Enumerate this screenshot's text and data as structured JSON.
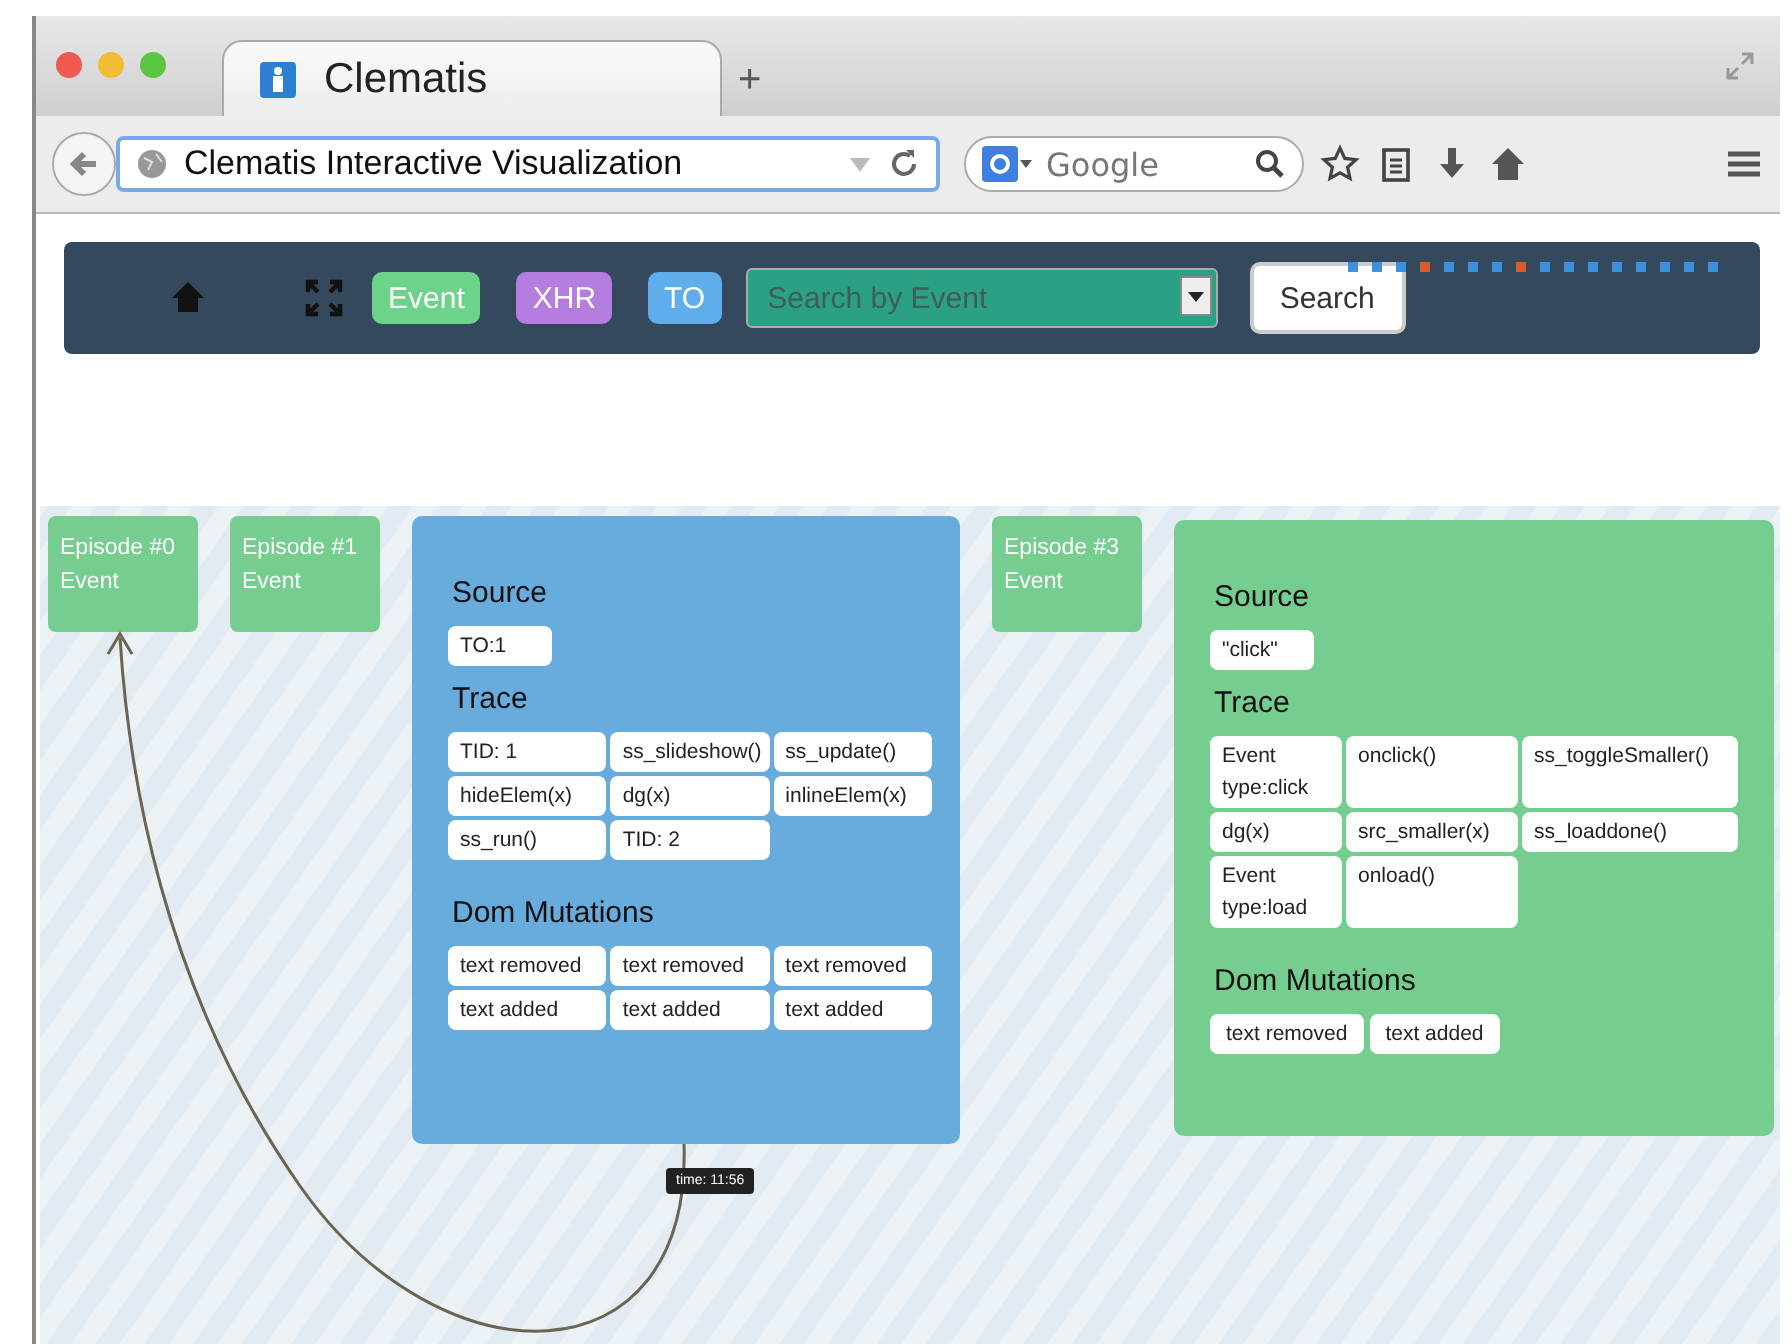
{
  "browser": {
    "tab_title": "Clematis",
    "new_tab": "+",
    "address": "Clematis Interactive Visualization",
    "search_placeholder": "Google"
  },
  "navbar": {
    "filters": [
      {
        "label": "Event",
        "color": "#6dd28a"
      },
      {
        "label": "XHR",
        "color": "#b57ddf"
      },
      {
        "label": "TO",
        "color": "#5fadea"
      }
    ],
    "search": {
      "placeholder": "Search by Event"
    },
    "search_button": "Search"
  },
  "episodes": [
    {
      "kind": "collapsed",
      "title": "Episode #0",
      "type": "Event",
      "color": "#75cd90"
    },
    {
      "kind": "collapsed",
      "title": "Episode #1",
      "type": "Event",
      "color": "#75cd90"
    },
    {
      "kind": "expanded",
      "color": "#67acdc",
      "sections": [
        {
          "heading": "Source",
          "items": [
            "TO:1"
          ]
        },
        {
          "heading": "Trace",
          "items": [
            "TID: 1",
            "ss_slideshow()",
            "ss_update()",
            "hideElem(x)",
            "dg(x)",
            "inlineElem(x)",
            "ss_run()",
            "TID: 2"
          ]
        },
        {
          "heading": "Dom Mutations",
          "items": [
            "text removed",
            "text removed",
            "text removed",
            "text added",
            "text added",
            "text added"
          ]
        }
      ]
    },
    {
      "kind": "collapsed",
      "title": "Episode #3",
      "type": "Event",
      "color": "#75cd90"
    },
    {
      "kind": "expanded",
      "color": "#75cd90",
      "sections": [
        {
          "heading": "Source",
          "items": [
            "\"click\""
          ]
        },
        {
          "heading": "Trace",
          "items": [
            "Event type:click",
            "onclick()",
            "ss_toggleSmaller()",
            "dg(x)",
            "src_smaller(x)",
            "ss_loaddone()",
            "Event type:load",
            "onload()"
          ]
        },
        {
          "heading": "Dom Mutations",
          "items": [
            "text removed",
            "text added"
          ]
        }
      ]
    }
  ],
  "tooltip": "time: 11:56"
}
